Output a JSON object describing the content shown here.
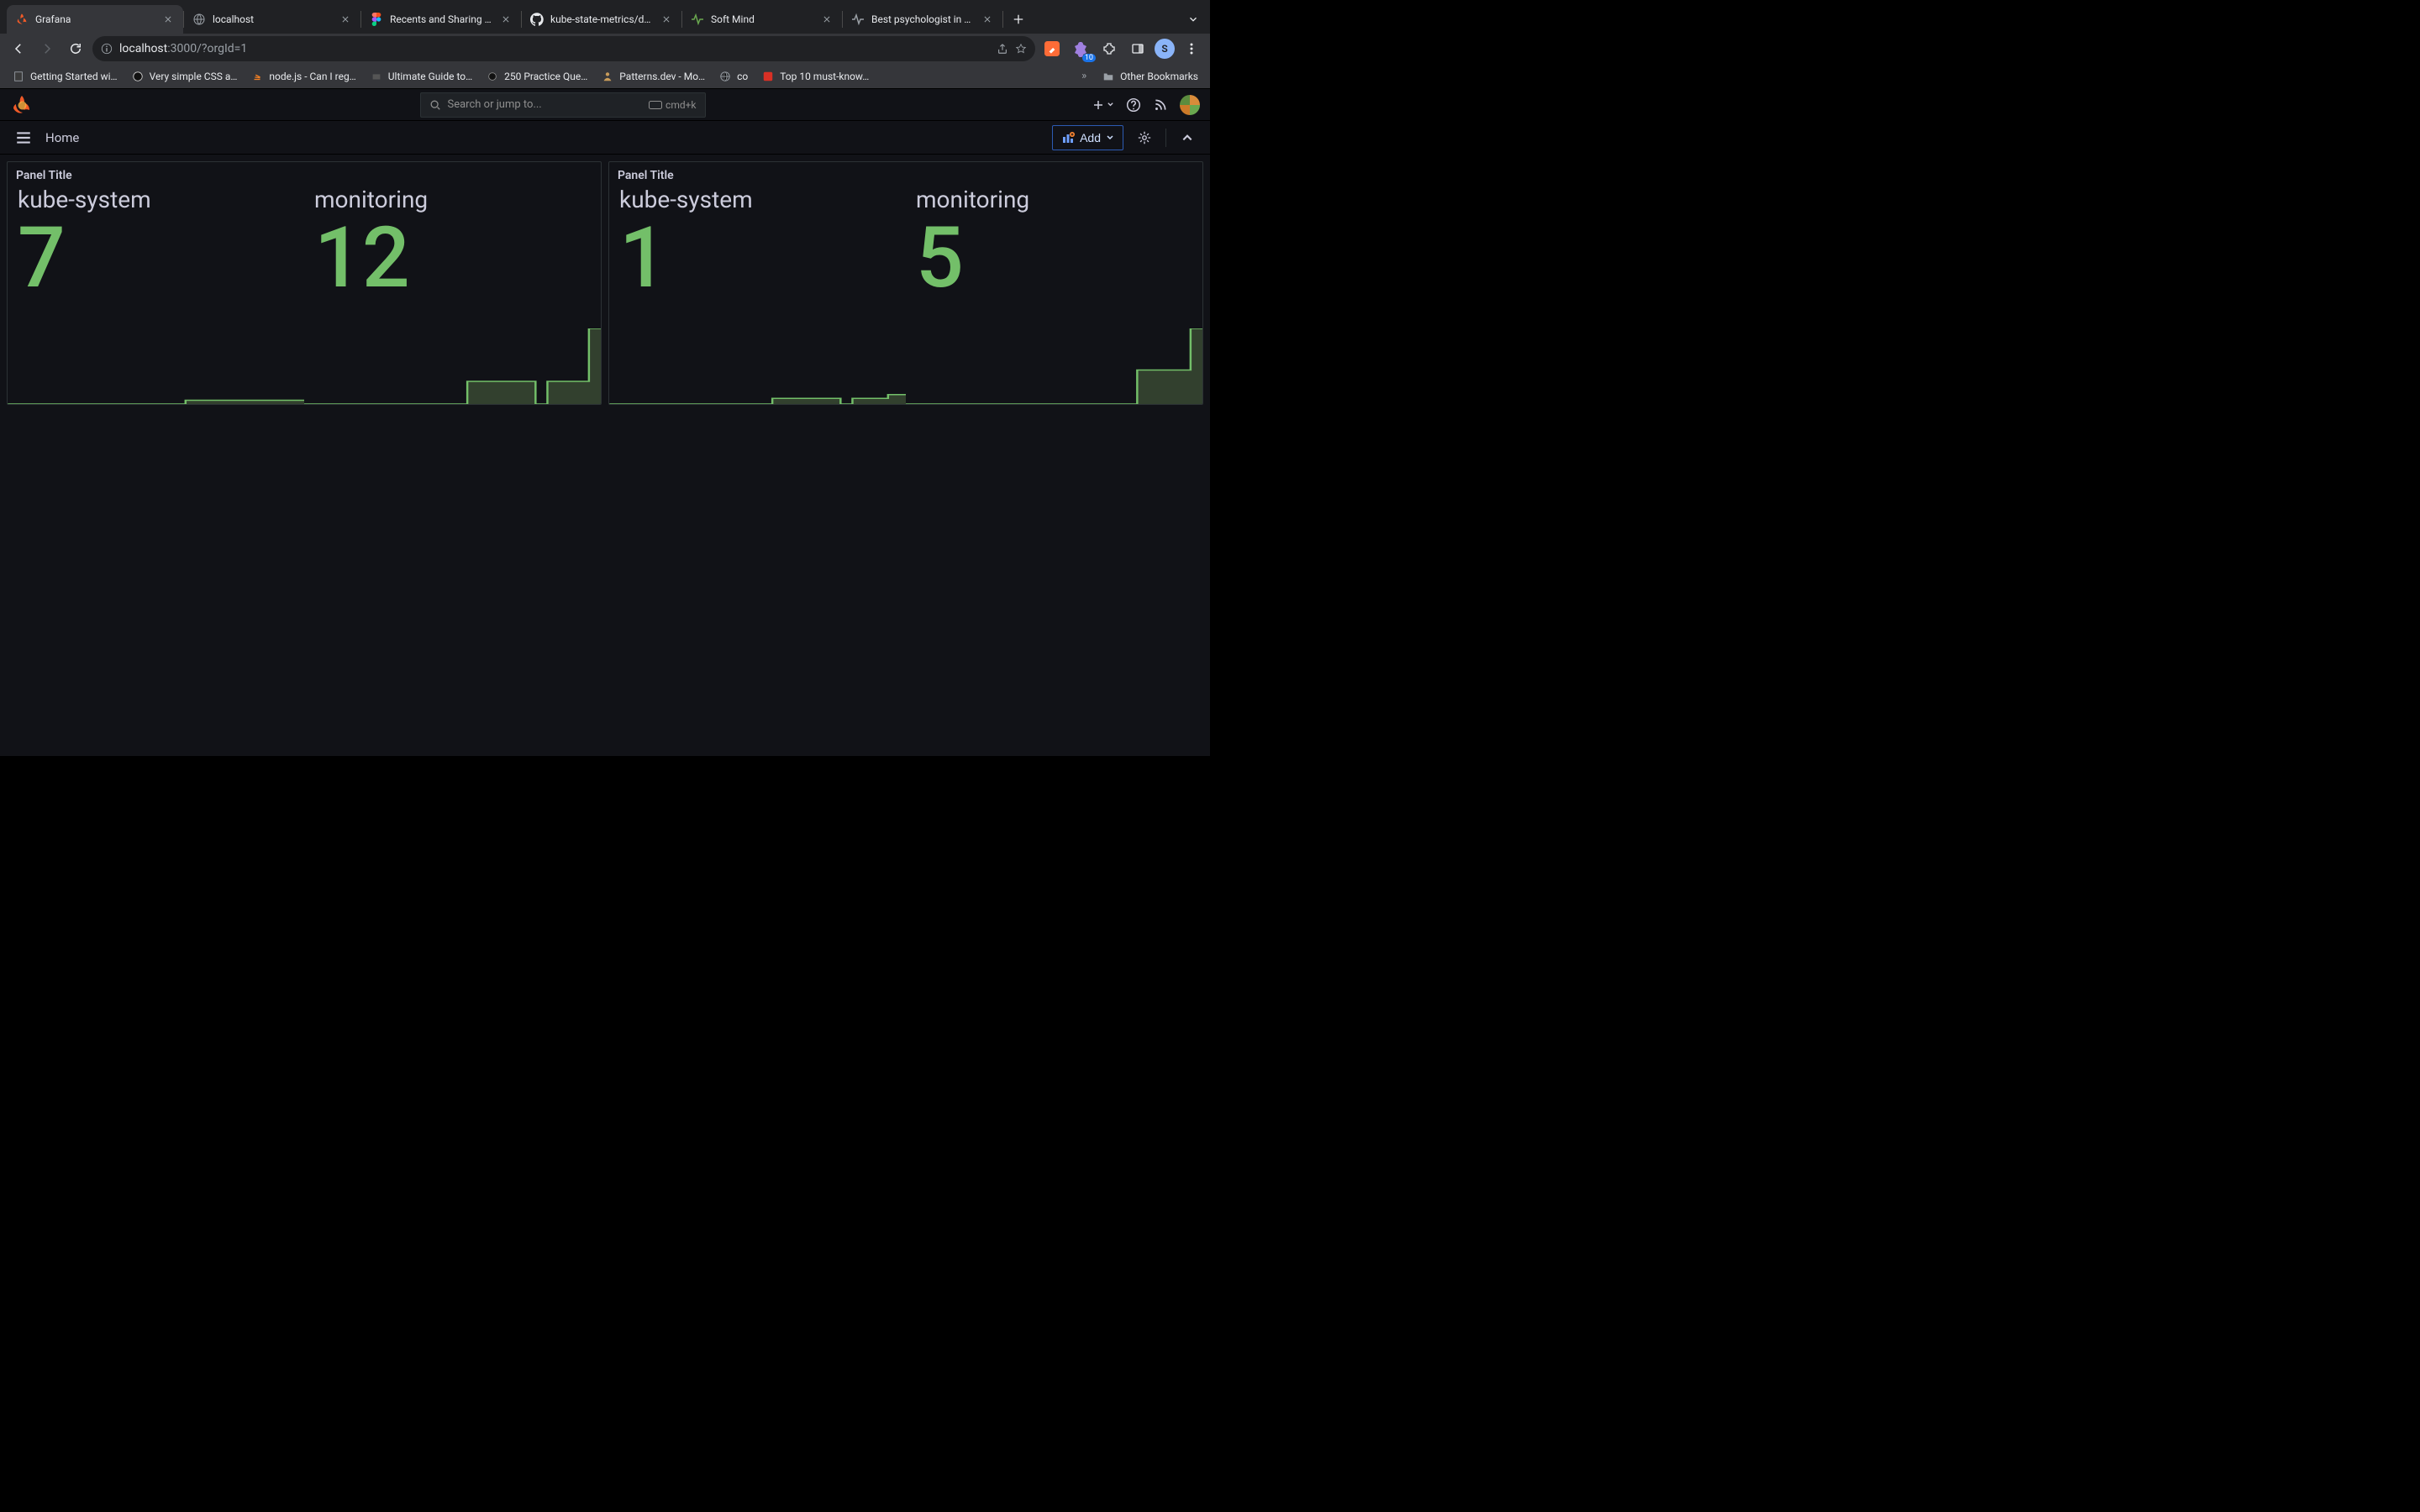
{
  "browser": {
    "tabs": [
      {
        "title": "Grafana",
        "active": true,
        "favicon": "grafana"
      },
      {
        "title": "localhost",
        "active": false,
        "favicon": "globe"
      },
      {
        "title": "Recents and Sharing – Fig…",
        "active": false,
        "favicon": "figma"
      },
      {
        "title": "kube-state-metrics/docs/p…",
        "active": false,
        "favicon": "github"
      },
      {
        "title": "Soft Mind",
        "active": false,
        "favicon": "pulse"
      },
      {
        "title": "Best psychologist in Kochi,",
        "active": false,
        "favicon": "pulse-dim"
      }
    ],
    "url_secure": "localhost",
    "url_rest": ":3000/?orgId=1",
    "profile_initial": "S",
    "ext_badge_count": "10",
    "bookmarks": [
      {
        "label": "Getting Started wi…",
        "icon": "doc"
      },
      {
        "label": "Very simple CSS a…",
        "icon": "css"
      },
      {
        "label": "node.js - Can I reg…",
        "icon": "so"
      },
      {
        "label": "Ultimate Guide to…",
        "icon": "box"
      },
      {
        "label": "250 Practice Que…",
        "icon": "dot"
      },
      {
        "label": "Patterns.dev - Mo…",
        "icon": "person"
      },
      {
        "label": "co",
        "icon": "globe"
      },
      {
        "label": "Top 10 must-know…",
        "icon": "red"
      }
    ],
    "other_bookmarks": "Other Bookmarks"
  },
  "grafana": {
    "search_placeholder": "Search or jump to...",
    "search_kbd": "cmd+k",
    "breadcrumb": "Home",
    "add_label": "Add",
    "panels": [
      {
        "title": "Panel Title",
        "stats": [
          {
            "label": "kube-system",
            "value": "7"
          },
          {
            "label": "monitoring",
            "value": "12"
          }
        ]
      },
      {
        "title": "Panel Title",
        "stats": [
          {
            "label": "kube-system",
            "value": "1"
          },
          {
            "label": "monitoring",
            "value": "5"
          }
        ]
      }
    ]
  },
  "chart_data": [
    {
      "type": "area",
      "title": "Panel Title (left) — kube-system sparkline",
      "x": [
        0,
        1,
        2,
        3,
        4,
        5,
        6,
        7,
        8,
        9
      ],
      "values": [
        0,
        0,
        0,
        0,
        0,
        0,
        1,
        1,
        1,
        1
      ],
      "ylim": [
        0,
        12
      ]
    },
    {
      "type": "area",
      "title": "Panel Title (left) — monitoring sparkline",
      "x": [
        0,
        1,
        2,
        3,
        4,
        5,
        6,
        7,
        8,
        9
      ],
      "values": [
        0,
        0,
        0,
        0,
        0,
        0,
        0,
        4,
        4,
        12
      ],
      "ylim": [
        0,
        12
      ]
    },
    {
      "type": "area",
      "title": "Panel Title (right) — kube-system sparkline",
      "x": [
        0,
        1,
        2,
        3,
        4,
        5,
        6,
        7,
        8,
        9
      ],
      "values": [
        0,
        0,
        0,
        0,
        0,
        0,
        1,
        1,
        1,
        1
      ],
      "ylim": [
        0,
        5
      ]
    },
    {
      "type": "area",
      "title": "Panel Title (right) — monitoring sparkline",
      "x": [
        0,
        1,
        2,
        3,
        4,
        5,
        6,
        7,
        8,
        9
      ],
      "values": [
        0,
        0,
        0,
        0,
        0,
        0,
        0,
        2,
        2,
        5
      ],
      "ylim": [
        0,
        5
      ]
    }
  ]
}
